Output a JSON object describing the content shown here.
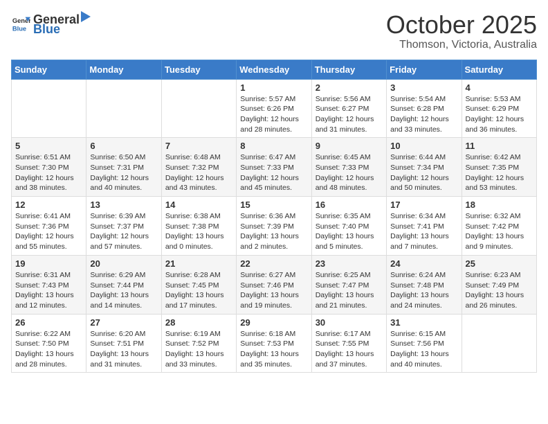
{
  "logo": {
    "general": "General",
    "blue": "Blue"
  },
  "title": "October 2025",
  "location": "Thomson, Victoria, Australia",
  "days_of_week": [
    "Sunday",
    "Monday",
    "Tuesday",
    "Wednesday",
    "Thursday",
    "Friday",
    "Saturday"
  ],
  "weeks": [
    [
      {
        "day": "",
        "info": ""
      },
      {
        "day": "",
        "info": ""
      },
      {
        "day": "",
        "info": ""
      },
      {
        "day": "1",
        "info": "Sunrise: 5:57 AM\nSunset: 6:26 PM\nDaylight: 12 hours\nand 28 minutes."
      },
      {
        "day": "2",
        "info": "Sunrise: 5:56 AM\nSunset: 6:27 PM\nDaylight: 12 hours\nand 31 minutes."
      },
      {
        "day": "3",
        "info": "Sunrise: 5:54 AM\nSunset: 6:28 PM\nDaylight: 12 hours\nand 33 minutes."
      },
      {
        "day": "4",
        "info": "Sunrise: 5:53 AM\nSunset: 6:29 PM\nDaylight: 12 hours\nand 36 minutes."
      }
    ],
    [
      {
        "day": "5",
        "info": "Sunrise: 6:51 AM\nSunset: 7:30 PM\nDaylight: 12 hours\nand 38 minutes."
      },
      {
        "day": "6",
        "info": "Sunrise: 6:50 AM\nSunset: 7:31 PM\nDaylight: 12 hours\nand 40 minutes."
      },
      {
        "day": "7",
        "info": "Sunrise: 6:48 AM\nSunset: 7:32 PM\nDaylight: 12 hours\nand 43 minutes."
      },
      {
        "day": "8",
        "info": "Sunrise: 6:47 AM\nSunset: 7:33 PM\nDaylight: 12 hours\nand 45 minutes."
      },
      {
        "day": "9",
        "info": "Sunrise: 6:45 AM\nSunset: 7:33 PM\nDaylight: 12 hours\nand 48 minutes."
      },
      {
        "day": "10",
        "info": "Sunrise: 6:44 AM\nSunset: 7:34 PM\nDaylight: 12 hours\nand 50 minutes."
      },
      {
        "day": "11",
        "info": "Sunrise: 6:42 AM\nSunset: 7:35 PM\nDaylight: 12 hours\nand 53 minutes."
      }
    ],
    [
      {
        "day": "12",
        "info": "Sunrise: 6:41 AM\nSunset: 7:36 PM\nDaylight: 12 hours\nand 55 minutes."
      },
      {
        "day": "13",
        "info": "Sunrise: 6:39 AM\nSunset: 7:37 PM\nDaylight: 12 hours\nand 57 minutes."
      },
      {
        "day": "14",
        "info": "Sunrise: 6:38 AM\nSunset: 7:38 PM\nDaylight: 13 hours\nand 0 minutes."
      },
      {
        "day": "15",
        "info": "Sunrise: 6:36 AM\nSunset: 7:39 PM\nDaylight: 13 hours\nand 2 minutes."
      },
      {
        "day": "16",
        "info": "Sunrise: 6:35 AM\nSunset: 7:40 PM\nDaylight: 13 hours\nand 5 minutes."
      },
      {
        "day": "17",
        "info": "Sunrise: 6:34 AM\nSunset: 7:41 PM\nDaylight: 13 hours\nand 7 minutes."
      },
      {
        "day": "18",
        "info": "Sunrise: 6:32 AM\nSunset: 7:42 PM\nDaylight: 13 hours\nand 9 minutes."
      }
    ],
    [
      {
        "day": "19",
        "info": "Sunrise: 6:31 AM\nSunset: 7:43 PM\nDaylight: 13 hours\nand 12 minutes."
      },
      {
        "day": "20",
        "info": "Sunrise: 6:29 AM\nSunset: 7:44 PM\nDaylight: 13 hours\nand 14 minutes."
      },
      {
        "day": "21",
        "info": "Sunrise: 6:28 AM\nSunset: 7:45 PM\nDaylight: 13 hours\nand 17 minutes."
      },
      {
        "day": "22",
        "info": "Sunrise: 6:27 AM\nSunset: 7:46 PM\nDaylight: 13 hours\nand 19 minutes."
      },
      {
        "day": "23",
        "info": "Sunrise: 6:25 AM\nSunset: 7:47 PM\nDaylight: 13 hours\nand 21 minutes."
      },
      {
        "day": "24",
        "info": "Sunrise: 6:24 AM\nSunset: 7:48 PM\nDaylight: 13 hours\nand 24 minutes."
      },
      {
        "day": "25",
        "info": "Sunrise: 6:23 AM\nSunset: 7:49 PM\nDaylight: 13 hours\nand 26 minutes."
      }
    ],
    [
      {
        "day": "26",
        "info": "Sunrise: 6:22 AM\nSunset: 7:50 PM\nDaylight: 13 hours\nand 28 minutes."
      },
      {
        "day": "27",
        "info": "Sunrise: 6:20 AM\nSunset: 7:51 PM\nDaylight: 13 hours\nand 31 minutes."
      },
      {
        "day": "28",
        "info": "Sunrise: 6:19 AM\nSunset: 7:52 PM\nDaylight: 13 hours\nand 33 minutes."
      },
      {
        "day": "29",
        "info": "Sunrise: 6:18 AM\nSunset: 7:53 PM\nDaylight: 13 hours\nand 35 minutes."
      },
      {
        "day": "30",
        "info": "Sunrise: 6:17 AM\nSunset: 7:55 PM\nDaylight: 13 hours\nand 37 minutes."
      },
      {
        "day": "31",
        "info": "Sunrise: 6:15 AM\nSunset: 7:56 PM\nDaylight: 13 hours\nand 40 minutes."
      },
      {
        "day": "",
        "info": ""
      }
    ]
  ]
}
